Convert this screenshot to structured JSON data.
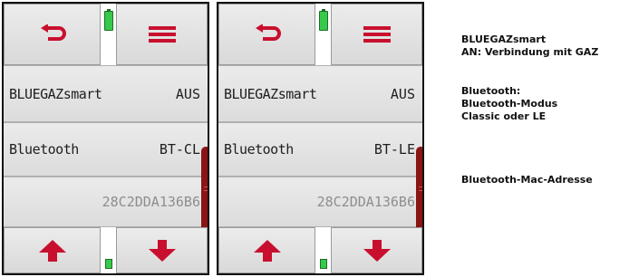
{
  "screens": [
    {
      "row1": {
        "label": "BLUEGAZsmart",
        "value": "AUS"
      },
      "row2": {
        "label": "Bluetooth",
        "value": "BT-CL"
      },
      "row3": {
        "value": "28C2DDA136B6"
      }
    },
    {
      "row1": {
        "label": "BLUEGAZsmart",
        "value": "AUS"
      },
      "row2": {
        "label": "Bluetooth",
        "value": "BT-LE"
      },
      "row3": {
        "value": "28C2DDA136B6"
      }
    }
  ],
  "descriptions": {
    "bluegaz": [
      "BLUEGAZsmart",
      "AN: Verbindung mit GAZ"
    ],
    "bluetooth": [
      "Bluetooth:",
      "Bluetooth-Modus",
      "Classic oder LE"
    ],
    "mac": [
      "Bluetooth-Mac-Adresse"
    ]
  },
  "colors": {
    "icon_red": "#c8102e",
    "battery_green": "#37c94a",
    "scrollbar": "#8b1414"
  },
  "icons": {
    "back": "back-arrow-icon",
    "menu": "menu-icon",
    "up": "up-arrow-icon",
    "down": "down-arrow-icon",
    "battery": "battery-icon"
  }
}
